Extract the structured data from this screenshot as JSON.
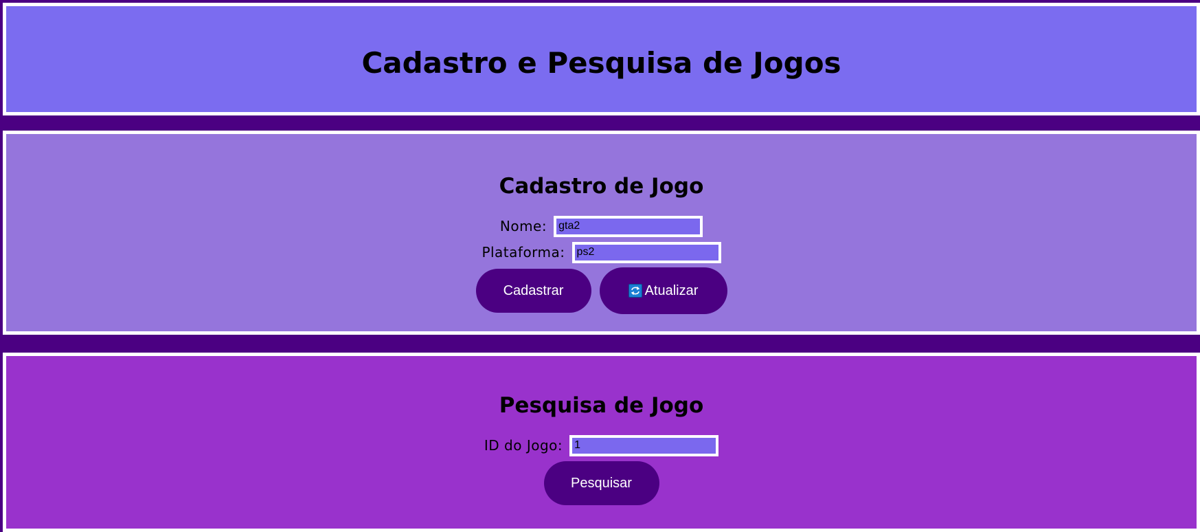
{
  "header": {
    "title": "Cadastro e Pesquisa de Jogos"
  },
  "cadastro": {
    "title": "Cadastro de Jogo",
    "nome_label": "Nome:",
    "nome_value": "gta2",
    "plataforma_label": "Plataforma:",
    "plataforma_value": "ps2",
    "cadastrar_label": "Cadastrar",
    "atualizar_label": "Atualizar",
    "atualizar_icon": "refresh-icon"
  },
  "pesquisa": {
    "title": "Pesquisa de Jogo",
    "id_label": "ID do Jogo:",
    "id_value": "1",
    "pesquisar_label": "Pesquisar"
  },
  "colors": {
    "page_background": "#4b0082",
    "header_background": "#7b6cf0",
    "cadastro_background": "#9575dc",
    "pesquisa_background": "#9932cc",
    "input_background": "#7b68ee",
    "button_background": "#4b0082",
    "border": "#ffffff"
  }
}
